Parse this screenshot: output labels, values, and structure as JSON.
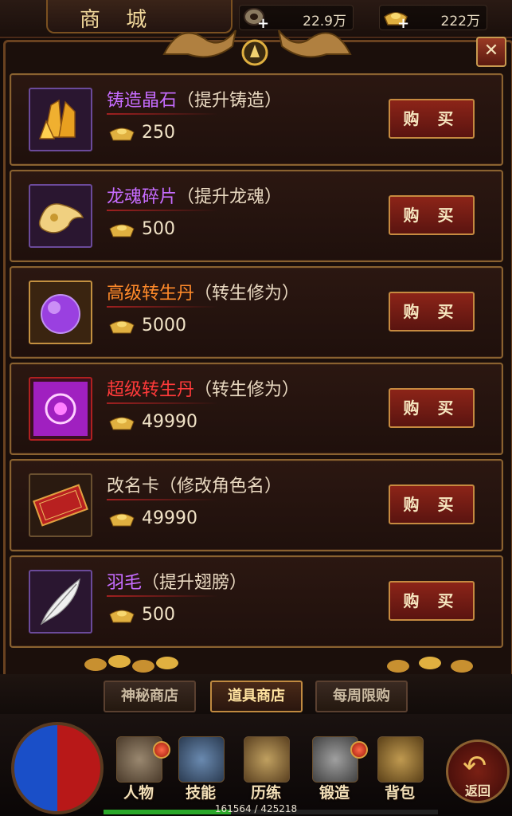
{
  "header": {
    "title": "商 城",
    "currencies": [
      {
        "icon": "jade-coin-icon",
        "value": "22.9万"
      },
      {
        "icon": "gold-ingot-icon",
        "value": "222万"
      }
    ]
  },
  "items": [
    {
      "name": "铸造晶石",
      "desc": "（提升铸造）",
      "price": "250",
      "name_color": "#c66cff",
      "icon": "crystal-icon",
      "buy_label": "购 买"
    },
    {
      "name": "龙魂碎片",
      "desc": "（提升龙魂）",
      "price": "500",
      "name_color": "#c66cff",
      "icon": "dragon-soul-icon",
      "buy_label": "购 买"
    },
    {
      "name": "高级转生丹",
      "desc": "（转生修为）",
      "price": "5000",
      "name_color": "#ff8a2a",
      "icon": "purple-orb-icon",
      "buy_label": "购 买"
    },
    {
      "name": "超级转生丹",
      "desc": "（转生修为）",
      "price": "49990",
      "name_color": "#ff3a3a",
      "icon": "magic-pill-icon",
      "buy_label": "购 买"
    },
    {
      "name": "改名卡",
      "desc": "（修改角色名）",
      "price": "49990",
      "name_color": "#e8d8c0",
      "icon": "rename-card-icon",
      "buy_label": "购 买"
    },
    {
      "name": "羽毛",
      "desc": "（提升翅膀）",
      "price": "500",
      "name_color": "#c66cff",
      "icon": "feather-icon",
      "buy_label": "购 买"
    }
  ],
  "tabs": [
    {
      "label": "神秘商店",
      "active": false
    },
    {
      "label": "道具商店",
      "active": true
    },
    {
      "label": "每周限购",
      "active": false
    }
  ],
  "nav": [
    {
      "label": "人物",
      "icon": "helmet-icon"
    },
    {
      "label": "技能",
      "icon": "skill-book-icon"
    },
    {
      "label": "历练",
      "icon": "armor-icon"
    },
    {
      "label": "锻造",
      "icon": "anvil-icon"
    },
    {
      "label": "背包",
      "icon": "bag-icon"
    }
  ],
  "back_label": "返回",
  "experience": {
    "text": "161564 / 425218",
    "current": 161564,
    "max": 425218
  }
}
